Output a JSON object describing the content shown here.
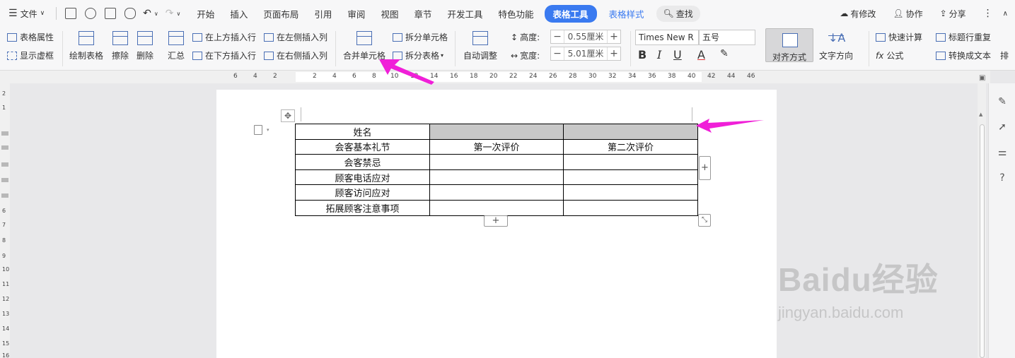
{
  "menubar": {
    "file_label": "文件",
    "tabs": [
      "开始",
      "插入",
      "页面布局",
      "引用",
      "审阅",
      "视图",
      "章节",
      "开发工具",
      "特色功能"
    ],
    "active_tab": "表格工具",
    "next_tab": "表格样式",
    "search_label": "查找",
    "right_items": [
      "有修改",
      "协作",
      "分享"
    ]
  },
  "ribbon": {
    "table_props": "表格属性",
    "show_gridlines": "显示虚框",
    "draw_table": "绘制表格",
    "erase": "擦除",
    "delete": "删除",
    "summarize": "汇总",
    "insert_above": "在上方插入行",
    "insert_below": "在下方插入行",
    "insert_left": "在左侧插入列",
    "insert_right": "在右侧插入列",
    "merge_cells": "合并单元格",
    "split_cells": "拆分单元格",
    "split_table": "拆分表格",
    "auto_fit": "自动调整",
    "height_label": "高度:",
    "height_value": "0.55厘米",
    "width_label": "宽度:",
    "width_value": "5.01厘米",
    "font_name": "Times New R",
    "font_size": "五号",
    "align": "对齐方式",
    "text_direction": "文字方向",
    "quick_calc": "快速计算",
    "repeat_header": "标题行重复",
    "formula": "公式",
    "convert_text": "转换成文本",
    "sort_partial": "排"
  },
  "ruler_ticks": [
    "6",
    "4",
    "2",
    "2",
    "4",
    "6",
    "8",
    "10",
    "12",
    "14",
    "16",
    "18",
    "20",
    "22",
    "24",
    "26",
    "28",
    "30",
    "32",
    "34",
    "36",
    "38",
    "40",
    "42",
    "44",
    "46"
  ],
  "vruler_ticks": [
    "2",
    "1",
    "6",
    "7",
    "8",
    "9",
    "10",
    "11",
    "12",
    "13",
    "14",
    "15",
    "16"
  ],
  "table": {
    "rows": [
      [
        "姓名",
        "",
        ""
      ],
      [
        "会客基本礼节",
        "第一次评价",
        "第二次评价"
      ],
      [
        "会客禁忌",
        "",
        ""
      ],
      [
        "顾客电话应对",
        "",
        ""
      ],
      [
        "顾客访问应对",
        "",
        ""
      ],
      [
        "拓展顾客注意事项",
        "",
        ""
      ]
    ]
  },
  "watermark": {
    "main": "Baidu经验",
    "sub": "jingyan.baidu.com"
  },
  "colors": {
    "accent": "#3a7af0",
    "arrow": "#f01fd8",
    "shade": "#c8c8c8"
  }
}
